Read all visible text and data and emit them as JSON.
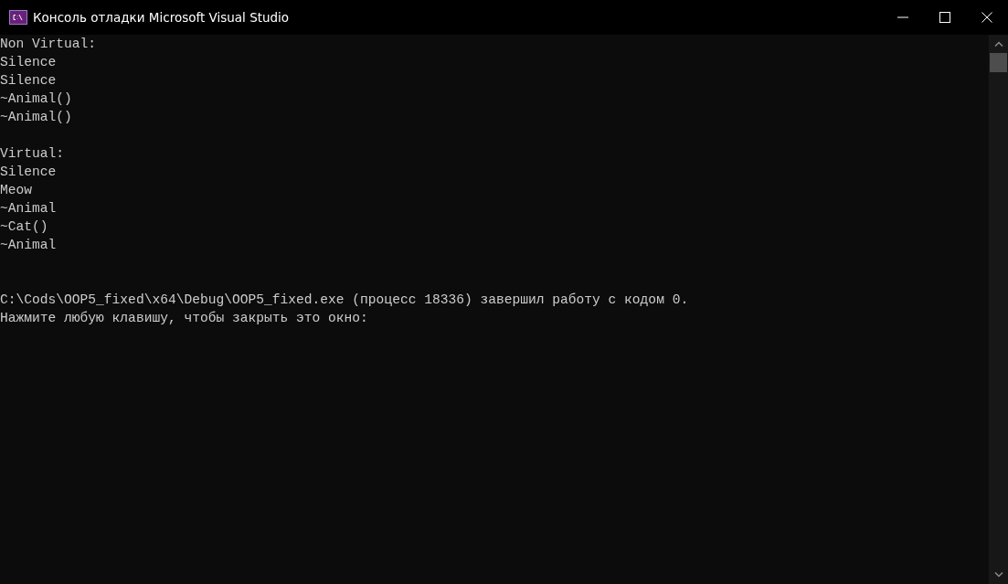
{
  "window": {
    "title": "Консоль отладки Microsoft Visual Studio"
  },
  "console": {
    "lines": [
      {
        "kind": "text",
        "text": "Non Virtual:"
      },
      {
        "kind": "text",
        "text": "Silence"
      },
      {
        "kind": "text",
        "text": "Silence"
      },
      {
        "kind": "text",
        "text": "~Animal()"
      },
      {
        "kind": "text",
        "text": "~Animal()"
      },
      {
        "kind": "blank"
      },
      {
        "kind": "text",
        "text": "Virtual:"
      },
      {
        "kind": "text",
        "text": "Silence"
      },
      {
        "kind": "text",
        "text": "Meow"
      },
      {
        "kind": "text",
        "text": "~Animal"
      },
      {
        "kind": "text",
        "text": "~Cat()"
      },
      {
        "kind": "text",
        "text": "~Animal"
      },
      {
        "kind": "blank"
      },
      {
        "kind": "blank"
      },
      {
        "kind": "text",
        "text": "C:\\Cods\\OOP5_fixed\\x64\\Debug\\OOP5_fixed.exe (процесс 18336) завершил работу с кодом 0."
      },
      {
        "kind": "text",
        "text": "Нажмите любую клавишу, чтобы закрыть это окно:"
      }
    ]
  }
}
